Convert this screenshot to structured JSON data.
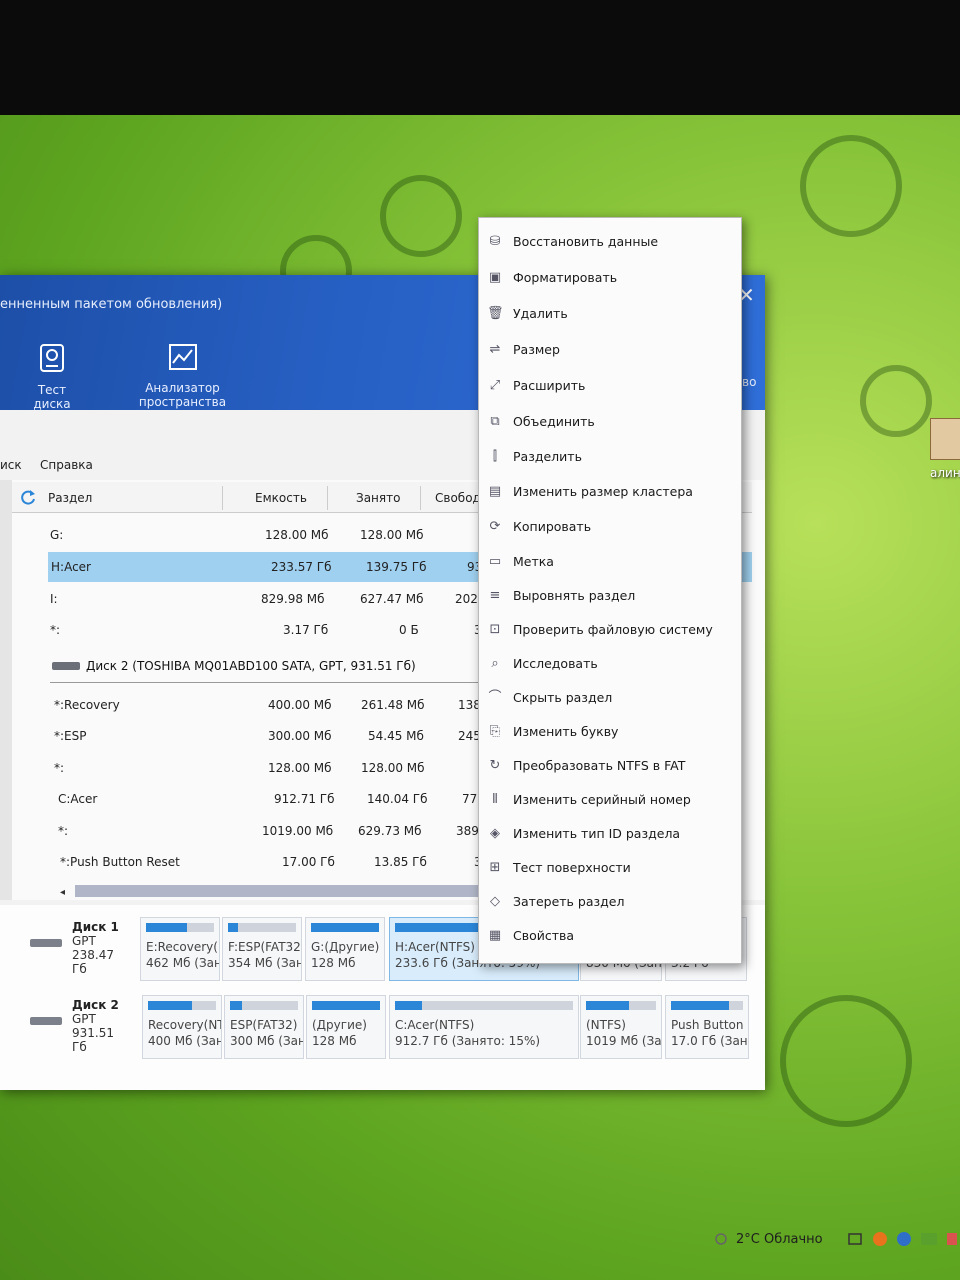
{
  "window": {
    "title": "енненным пакетом обновления)",
    "close": "✕",
    "tools": [
      {
        "label": "Тест диска",
        "icon": "disk-test-icon"
      },
      {
        "label": "Анализатор пространства",
        "icon": "space-analyzer-icon"
      }
    ],
    "right_title_fragment": "во"
  },
  "menu": {
    "items": [
      "иск",
      "Справка"
    ]
  },
  "table": {
    "headers": [
      "Раздел",
      "Емкость",
      "Занято",
      "Свобод"
    ],
    "rows": [
      {
        "name": "G:",
        "cap": "128.00 Мб",
        "used": "128.00 Мб",
        "free": ""
      },
      {
        "name": "H:Acer",
        "cap": "233.57 Гб",
        "used": "139.75 Гб",
        "free": "93"
      },
      {
        "name": "I:",
        "cap": "829.98 Мб",
        "used": "627.47 Мб",
        "free": "202."
      },
      {
        "name": "*:",
        "cap": "3.17 Гб",
        "used": "0 Б",
        "free": "3"
      }
    ],
    "disk2_header": "Диск 2 (TOSHIBA MQ01ABD100 SATA, GPT, 931.51 Гб)",
    "disk2_rows": [
      {
        "name": "*:Recovery",
        "cap": "400.00 Мб",
        "used": "261.48 Мб",
        "free": "138."
      },
      {
        "name": "*:ESP",
        "cap": "300.00 Мб",
        "used": "54.45 Мб",
        "free": "245."
      },
      {
        "name": "*:",
        "cap": "128.00 Мб",
        "used": "128.00 Мб",
        "free": ""
      },
      {
        "name": "C:Acer",
        "cap": "912.71 Гб",
        "used": "140.04 Гб",
        "free": "772"
      },
      {
        "name": "*:",
        "cap": "1019.00 Мб",
        "used": "629.73 Мб",
        "free": "389."
      },
      {
        "name": "*:Push Button Reset",
        "cap": "17.00 Гб",
        "used": "13.85 Гб",
        "free": "3"
      }
    ]
  },
  "diskmap": {
    "disk1": {
      "name": "Диск 1",
      "type": "GPT",
      "size": "238.47 Гб"
    },
    "disk2": {
      "name": "Диск 2",
      "type": "GPT",
      "size": "931.51 Гб"
    },
    "disk1_parts": [
      {
        "l1": "E:Recovery(N",
        "l2": "462 Мб (Зан",
        "fill": 0.6
      },
      {
        "l1": "F:ESP(FAT32)",
        "l2": "354 Мб (Зан",
        "fill": 0.15
      },
      {
        "l1": "G:(Другие)",
        "l2": "128 Мб",
        "fill": 1.0
      },
      {
        "l1": "H:Acer(NTFS)",
        "l2": "233.6 Гб (Занято: 59%)",
        "fill": 0.59
      },
      {
        "l1": "",
        "l2": "830 Мб (Зан",
        "fill": 0.75
      },
      {
        "l1": "",
        "l2": "3.2 Гб",
        "fill": 0.0
      }
    ],
    "disk2_parts": [
      {
        "l1": "Recovery(NTI",
        "l2": "400 Мб (Зан",
        "fill": 0.65
      },
      {
        "l1": "ESP(FAT32)",
        "l2": "300 Мб (Зан",
        "fill": 0.18
      },
      {
        "l1": "(Другие)",
        "l2": "128 Мб",
        "fill": 1.0
      },
      {
        "l1": "C:Acer(NTFS)",
        "l2": "912.7 Гб (Занято: 15%)",
        "fill": 0.15
      },
      {
        "l1": "(NTFS)",
        "l2": "1019 Мб (За",
        "fill": 0.62
      },
      {
        "l1": "Push Button",
        "l2": "17.0 Гб (Заня",
        "fill": 0.81
      }
    ]
  },
  "context_menu": [
    {
      "label": "Восстановить данные",
      "icon": "recover-icon"
    },
    {
      "label": "Форматировать",
      "icon": "format-icon"
    },
    {
      "label": "Удалить",
      "icon": "delete-icon"
    },
    {
      "label": "Размер",
      "icon": "resize-icon"
    },
    {
      "label": "Расширить",
      "icon": "extend-icon"
    },
    {
      "label": "Объединить",
      "icon": "merge-icon"
    },
    {
      "label": "Разделить",
      "icon": "split-icon"
    },
    {
      "label": "Изменить размер кластера",
      "icon": "cluster-size-icon"
    },
    {
      "label": "Копировать",
      "icon": "copy-icon"
    },
    {
      "label": "Метка",
      "icon": "label-icon"
    },
    {
      "label": "Выровнять раздел",
      "icon": "align-icon"
    },
    {
      "label": "Проверить файловую систему",
      "icon": "check-fs-icon"
    },
    {
      "label": "Исследовать",
      "icon": "explore-icon"
    },
    {
      "label": "Скрыть раздел",
      "icon": "hide-icon"
    },
    {
      "label": "Изменить букву",
      "icon": "change-letter-icon"
    },
    {
      "label": "Преобразовать NTFS в FAT",
      "icon": "convert-icon"
    },
    {
      "label": "Изменить серийный номер",
      "icon": "serial-icon"
    },
    {
      "label": "Изменить тип ID раздела",
      "icon": "type-id-icon"
    },
    {
      "label": "Тест поверхности",
      "icon": "surface-test-icon"
    },
    {
      "label": "Затереть раздел",
      "icon": "wipe-icon"
    },
    {
      "label": "Свойства",
      "icon": "properties-icon"
    }
  ],
  "desktop_icon": {
    "label": "алин"
  },
  "taskbar": {
    "weather": "2°C  Облачно"
  },
  "colors": {
    "accent": "#2760c4",
    "selection": "#9fd0ef",
    "bar": "#2c86d8"
  }
}
